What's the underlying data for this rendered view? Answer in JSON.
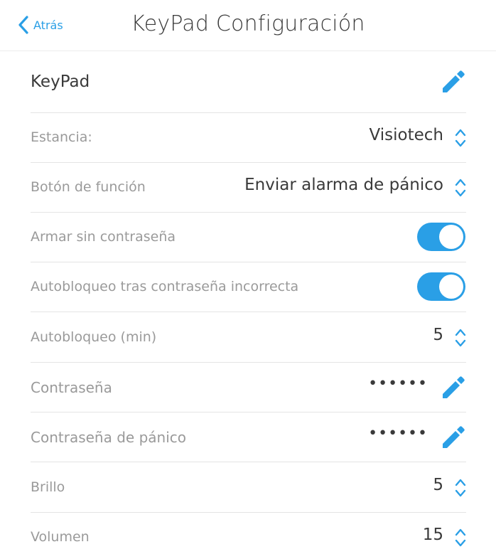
{
  "header": {
    "back_label": "Atrás",
    "title": "KeyPad Configuración"
  },
  "device": {
    "name": "KeyPad"
  },
  "settings": {
    "estancia": {
      "label": "Estancia:",
      "value": "Visiotech"
    },
    "boton_funcion": {
      "label": "Botón de función",
      "value": "Enviar alarma de pánico"
    },
    "armar_sin_contrasena": {
      "label": "Armar sin contraseña",
      "enabled": true
    },
    "autobloqueo_incorrecta": {
      "label": "Autobloqueo tras contraseña incorrecta",
      "enabled": true
    },
    "autobloqueo_min": {
      "label": "Autobloqueo (min)",
      "value": "5"
    },
    "contrasena": {
      "label": "Contraseña",
      "masked": "••••••"
    },
    "contrasena_panico": {
      "label": "Contraseña de pánico",
      "masked": "••••••"
    },
    "brillo": {
      "label": "Brillo",
      "value": "5"
    },
    "volumen": {
      "label": "Volumen",
      "value": "15"
    }
  },
  "colors": {
    "accent": "#2a9fe6",
    "label_gray": "#9a9a9a",
    "text_dark": "#3a3a3a",
    "divider": "#e4e4e4"
  },
  "icons": {
    "back": "chevron-left-icon",
    "edit": "pencil-icon",
    "stepper": "chevron-up-down-icon"
  }
}
